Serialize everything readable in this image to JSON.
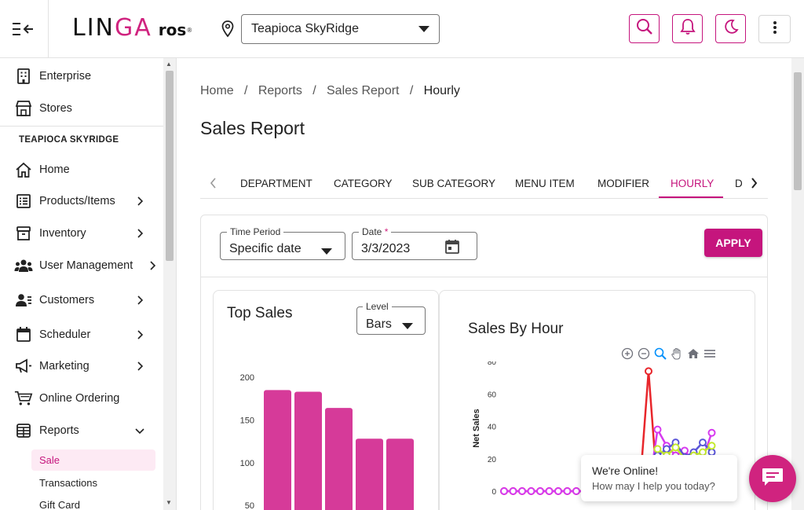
{
  "app": {
    "logo_main_left": "LIN",
    "logo_main_pink": "GA",
    "logo_sub": "ros",
    "logo_reg": "®",
    "store_name": "Teapioca SkyRidge",
    "accent": "#c5157d"
  },
  "sidebar": {
    "top_items": [
      {
        "label": "Enterprise",
        "icon": "building-icon"
      },
      {
        "label": "Stores",
        "icon": "store-icon"
      }
    ],
    "store_heading": "TEAPIOCA SKYRIDGE",
    "items": [
      {
        "label": "Home",
        "icon": "home-icon",
        "has_children": false
      },
      {
        "label": "Products/Items",
        "icon": "list-icon",
        "has_children": true
      },
      {
        "label": "Inventory",
        "icon": "box-icon",
        "has_children": true
      },
      {
        "label": "User Management",
        "icon": "users-icon",
        "has_children": true
      },
      {
        "label": "Customers",
        "icon": "customers-icon",
        "has_children": true
      },
      {
        "label": "Scheduler",
        "icon": "calendar-icon",
        "has_children": true
      },
      {
        "label": "Marketing",
        "icon": "megaphone-icon",
        "has_children": true
      },
      {
        "label": "Online Ordering",
        "icon": "cart-icon",
        "has_children": false
      },
      {
        "label": "Reports",
        "icon": "reports-icon",
        "has_children": true,
        "expanded": true
      }
    ],
    "report_subitems": [
      {
        "label": "Sale",
        "active": true
      },
      {
        "label": "Transactions",
        "active": false
      },
      {
        "label": "Gift Card",
        "active": false
      }
    ]
  },
  "breadcrumb": {
    "items": [
      "Home",
      "Reports",
      "Sales Report",
      "Hourly"
    ],
    "separator": "/"
  },
  "page": {
    "title": "Sales Report"
  },
  "tabs": {
    "items": [
      "DEPARTMENT",
      "CATEGORY",
      "SUB CATEGORY",
      "MENU ITEM",
      "MODIFIER",
      "HOURLY",
      "D"
    ],
    "active": "HOURLY"
  },
  "filters": {
    "time_period_label": "Time Period",
    "time_period_value": "Specific date",
    "date_label": "Date",
    "date_required": "*",
    "date_value": "3/3/2023",
    "apply_label": "APPLY"
  },
  "top_sales": {
    "title": "Top Sales",
    "level_label": "Level",
    "level_value": "Bars"
  },
  "sales_by_hour": {
    "title": "Sales By Hour",
    "toolbar": [
      "zoom-in-icon",
      "zoom-out-icon",
      "magnify-icon",
      "pan-icon",
      "home-icon",
      "menu-icon"
    ]
  },
  "chart_data": [
    {
      "type": "bar",
      "yticks": [
        "200",
        "150",
        "100",
        "50"
      ],
      "ylim": [
        40,
        200
      ],
      "values": [
        185,
        183,
        164,
        128,
        128
      ],
      "bar_color": "#d63a99",
      "grid": false
    },
    {
      "type": "line",
      "ylabel": "Net Sales",
      "yticks": [
        "80",
        "60",
        "40",
        "20",
        "0"
      ],
      "ylim": [
        0,
        80
      ],
      "series": [
        {
          "color": "#e8262b",
          "x": [
            0,
            1,
            2,
            3,
            4,
            5,
            6,
            7,
            8,
            9,
            10,
            11,
            12,
            13,
            14,
            15,
            16,
            17,
            18,
            19,
            20,
            21,
            22,
            23
          ],
          "values": [
            0,
            0,
            0,
            0,
            0,
            0,
            0,
            0,
            0,
            0,
            0,
            0,
            0,
            0,
            0,
            0,
            74,
            0,
            0,
            0,
            0,
            0,
            0,
            0
          ]
        },
        {
          "color": "#d63aef",
          "x": [
            0,
            1,
            2,
            3,
            4,
            5,
            6,
            7,
            8,
            9,
            10,
            11,
            12,
            13,
            14,
            15,
            16,
            17,
            18,
            19,
            20,
            21,
            22,
            23
          ],
          "values": [
            0,
            0,
            0,
            0,
            0,
            0,
            0,
            0,
            0,
            0,
            0,
            0,
            0,
            0,
            0,
            0,
            0,
            38,
            28,
            22,
            25,
            18,
            20,
            36
          ]
        },
        {
          "color": "#5a55d8",
          "x": [
            17,
            18,
            19,
            20,
            21,
            22,
            23
          ],
          "values": [
            22,
            26,
            30,
            21,
            24,
            30,
            24
          ]
        },
        {
          "color": "#c4e92e",
          "x": [
            17,
            18,
            19,
            20,
            21,
            22,
            23
          ],
          "values": [
            26,
            22,
            27,
            20,
            22,
            24,
            28
          ]
        }
      ]
    }
  ],
  "chat": {
    "line1": "We're Online!",
    "line2": "How may I help you today?"
  }
}
